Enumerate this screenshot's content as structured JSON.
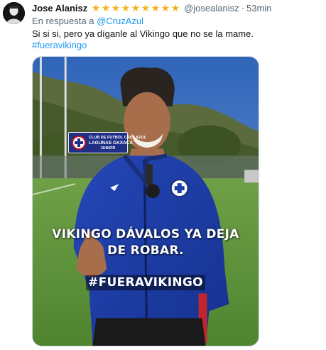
{
  "tweet": {
    "display_name": "Jose Alanisz",
    "badge_stars": [
      "★",
      "★",
      "★",
      "★",
      "★",
      "★",
      "★",
      "★",
      "★"
    ],
    "handle": "@josealanisz",
    "separator": "·",
    "time": "53min",
    "reply_prefix": "En respuesta a",
    "reply_mention": "@CruzAzul",
    "text": "Si si si, pero ya díganle al Vikingo que no se la mame.",
    "hashtag": "#fueravikingo"
  },
  "media": {
    "sign_lines": [
      "CLUB DE FUTBOL CRUZ AZUL",
      "LAGUNAS OAXACA",
      "JUNIOR"
    ],
    "caption_lines": [
      "VIKINGO DÁVALOS YA DEJA",
      "DE ROBAR."
    ],
    "overlay_hashtag": "#FUERAVIKINGO"
  },
  "colors": {
    "link": "#1d9bf0",
    "secondary_text": "#536471",
    "star": "#f5b31a",
    "jacket": "#1d3ea8"
  }
}
